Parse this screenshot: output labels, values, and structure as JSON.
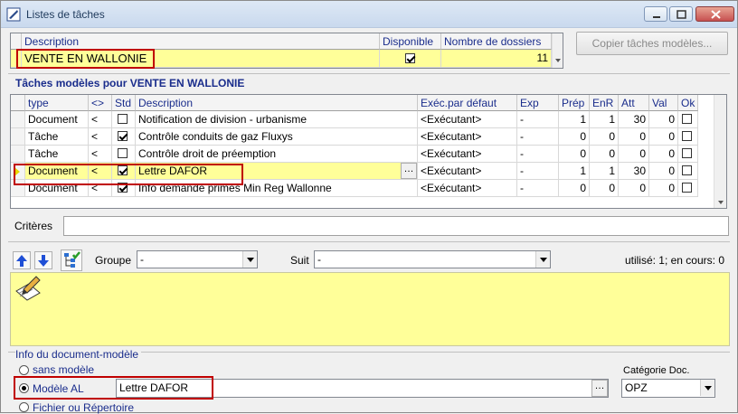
{
  "window": {
    "title": "Listes de tâches"
  },
  "top_grid": {
    "headers": {
      "description": "Description",
      "disponible": "Disponible",
      "nombre": "Nombre de dossiers"
    },
    "row": {
      "description": "VENTE EN WALLONIE",
      "disponible": true,
      "nombre": "11"
    }
  },
  "copy_button": {
    "label": "Copier tâches modèles..."
  },
  "section_taches": {
    "label": "Tâches modèles pour VENTE EN WALLONIE"
  },
  "task_grid": {
    "headers": [
      "type",
      "<>",
      "Std",
      "Description",
      "Exéc.par défaut",
      "Exp",
      "Prép",
      "EnR",
      "Att",
      "Val",
      "Ok"
    ],
    "rows": [
      {
        "type": "Document",
        "lt": "<",
        "std": false,
        "description": "Notification de division - urbanisme",
        "exec": "<Exécutant>",
        "exp": "-",
        "prep": "1",
        "enr": "1",
        "att": "30",
        "val": "0",
        "ok": false
      },
      {
        "type": "Tâche",
        "lt": "<",
        "std": true,
        "description": "Contrôle conduits de gaz Fluxys",
        "exec": "<Exécutant>",
        "exp": "-",
        "prep": "0",
        "enr": "0",
        "att": "0",
        "val": "0",
        "ok": false
      },
      {
        "type": "Tâche",
        "lt": "<",
        "std": false,
        "description": "Contrôle droit de préemption",
        "exec": "<Exécutant>",
        "exp": "-",
        "prep": "0",
        "enr": "0",
        "att": "0",
        "val": "0",
        "ok": false
      },
      {
        "type": "Document",
        "lt": "<",
        "std": true,
        "description": "Lettre DAFOR",
        "exec": "<Exécutant>",
        "exp": "-",
        "prep": "1",
        "enr": "1",
        "att": "30",
        "val": "0",
        "ok": false
      },
      {
        "type": "Document",
        "lt": "<",
        "std": true,
        "description": "Info demande primes Min Reg Wallonne",
        "exec": "<Exécutant>",
        "exp": "-",
        "prep": "0",
        "enr": "0",
        "att": "0",
        "val": "0",
        "ok": false
      }
    ]
  },
  "criteres": {
    "label": "Critères",
    "value": ""
  },
  "toolbar": {
    "groupe_label": "Groupe",
    "groupe_value": "-",
    "suit_label": "Suit",
    "suit_value": "-",
    "status": "utilisé: 1; en cours: 0"
  },
  "info_doc": {
    "label": "Info du document-modèle",
    "opt_sans": "sans modèle",
    "opt_modele": "Modèle AL",
    "modele_value": "Lettre DAFOR",
    "opt_fichier": "Fichier ou Répertoire",
    "categorie_label": "Catégorie Doc.",
    "categorie_value": "OPZ"
  },
  "colors": {
    "highlight": "#ffff99",
    "annotation": "#c00000",
    "header_text": "#1a2d8c"
  },
  "icons": [
    "app-icon",
    "minimize-icon",
    "maximize-icon",
    "close-icon",
    "arrow-up-icon",
    "arrow-down-icon",
    "tree-check-icon",
    "pencil-notes-icon",
    "row-pointer-icon",
    "ellipsis-icon"
  ]
}
